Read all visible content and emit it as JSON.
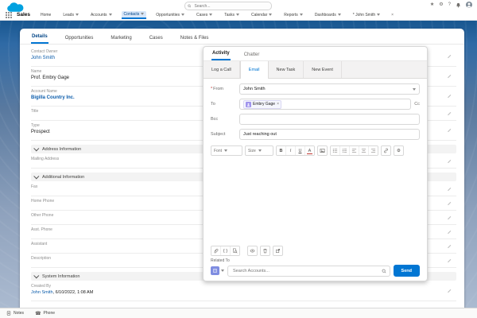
{
  "colors": {
    "accent": "#0176d3",
    "link": "#0b5cab",
    "header_band": "#17568f",
    "logo_blue": "#00a1e0",
    "contact_avatar": "#a094ed",
    "account_icon": "#7f8de1",
    "send_button": "#0176d3",
    "required_red": "#c23934"
  },
  "icons": {
    "close": "×",
    "star": "★",
    "gear": "⚙",
    "help": "?",
    "phone": "☎",
    "braces": "{ }"
  },
  "header": {
    "search_placeholder": "Search...",
    "app_name": "Sales",
    "nav": [
      {
        "label": "Home"
      },
      {
        "label": "Leads"
      },
      {
        "label": "Accounts"
      },
      {
        "label": "Contacts"
      },
      {
        "label": "Opportunities"
      },
      {
        "label": "Cases"
      },
      {
        "label": "Tasks"
      },
      {
        "label": "Calendar"
      },
      {
        "label": "Reports"
      },
      {
        "label": "Dashboards"
      }
    ],
    "temp_tab": "* John Smith"
  },
  "record_tabs": [
    {
      "label": "Details"
    },
    {
      "label": "Opportunities"
    },
    {
      "label": "Marketing"
    },
    {
      "label": "Cases"
    },
    {
      "label": "Notes & Files"
    }
  ],
  "details": {
    "fields": [
      {
        "label": "Contact Owner",
        "value": "John Smith"
      },
      {
        "label": "Name",
        "value": "Prof. Embry Gage"
      },
      {
        "label": "Account Name",
        "value": "Bigilla Country Inc."
      },
      {
        "label": "Title",
        "value": ""
      },
      {
        "label": "Type",
        "value": "Prospect"
      },
      {
        "label": "Mailing Address",
        "value": ""
      },
      {
        "label": "Fax",
        "value": ""
      },
      {
        "label": "Home Phone",
        "value": ""
      },
      {
        "label": "Other Phone",
        "value": ""
      },
      {
        "label": "Asst. Phone",
        "value": ""
      },
      {
        "label": "Assistant",
        "value": ""
      },
      {
        "label": "Description",
        "value": ""
      }
    ],
    "section_address": "Address Information",
    "section_additional": "Additional Information",
    "section_system": "System Information",
    "created_by": {
      "label": "Created By",
      "user": "John Smith",
      "datetime": ", 6/10/2022, 1:08 AM"
    }
  },
  "composer": {
    "tab_activity": "Activity",
    "tab_chatter": "Chatter",
    "subtabs": [
      {
        "label": "Log a Call"
      },
      {
        "label": "Email"
      },
      {
        "label": "New Task"
      },
      {
        "label": "New Event"
      }
    ],
    "required_mark": "*",
    "from_label": "From",
    "from_value": "John Smith",
    "to_label": "To",
    "to_pill": "Embry Gage",
    "cc_label": "Cc",
    "bcc_label": "Bcc",
    "subject_label": "Subject",
    "subject_value": "Just reaching out",
    "toolbar": {
      "font": "Font",
      "size": "Size",
      "bold": "B",
      "italic": "I",
      "underline": "U",
      "color": "A"
    },
    "related_to_label": "Related To",
    "search_placeholder": "Search Accounts...",
    "send_label": "Send"
  },
  "utility_bar": {
    "notes": "Notes",
    "phone": "Phone"
  }
}
